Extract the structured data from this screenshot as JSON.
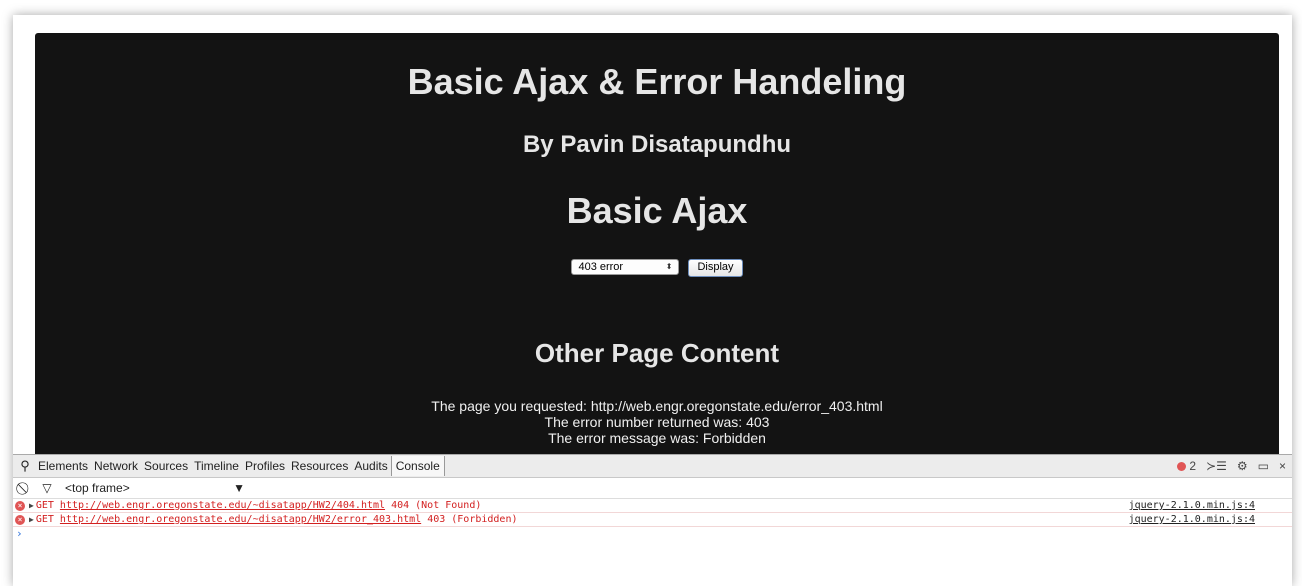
{
  "page": {
    "title": "Basic Ajax & Error Handeling",
    "author": "By Pavin Disatapundhu",
    "section_title": "Basic Ajax",
    "select_value": "403 error",
    "display_button": "Display",
    "other_title": "Other Page Content",
    "messages": [
      "The page you requested: http://web.engr.oregonstate.edu/error_403.html",
      "The error number returned was: 403",
      "The error message was: Forbidden"
    ]
  },
  "devtools": {
    "tabs": [
      "Elements",
      "Network",
      "Sources",
      "Timeline",
      "Profiles",
      "Resources",
      "Audits",
      "Console"
    ],
    "active_tab": "Console",
    "error_count": "2",
    "frame": "<top frame>",
    "console": [
      {
        "method": "GET",
        "url": "http://web.engr.oregonstate.edu/~disatapp/HW2/404.html",
        "status": "404 (Not Found)",
        "source": "jquery-2.1.0.min.js:4"
      },
      {
        "method": "GET",
        "url": "http://web.engr.oregonstate.edu/~disatapp/HW2/error_403.html",
        "status": "403 (Forbidden)",
        "source": "jquery-2.1.0.min.js:4"
      }
    ],
    "prompt": "›"
  },
  "colors": {
    "page_bg": "#131313",
    "error_red": "#d32020",
    "prompt_blue": "#2a6fdb"
  }
}
